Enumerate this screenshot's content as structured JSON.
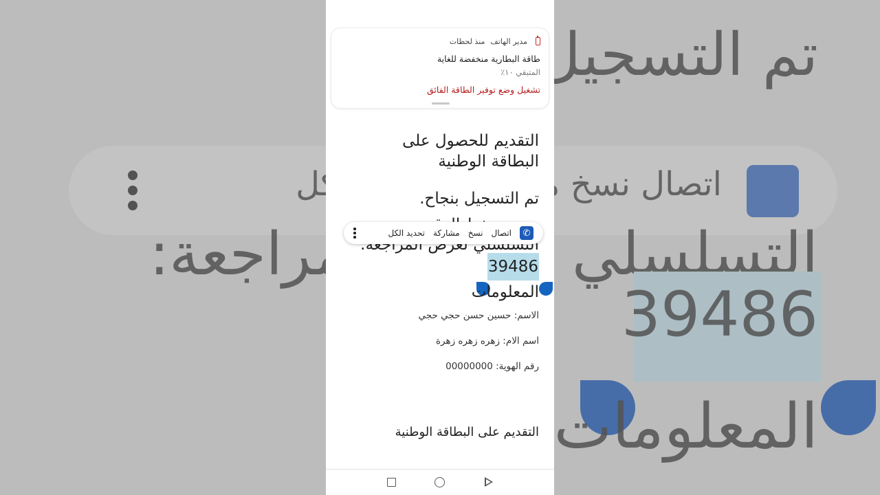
{
  "notification": {
    "app_name": "مدير الهاتف",
    "time": "منذ لحظات",
    "title": "طاقة البطارية منخفضة للغاية",
    "subtitle": "المتبقي ١٠٪",
    "action": "تشغيل وضع توفير الطاقة الفائق"
  },
  "page": {
    "heading_main": "التقديم للحصول على البطاقة الوطنية",
    "success_text": "تم التسجيل بنجاح.",
    "partial_line1": "يرجى حفظ الرقم",
    "partial_line2": "التسلسلي لغرض المراجعة:",
    "selected_number": "39486",
    "info_heading": "المعلومات",
    "name_line": "الاسم: حسين حسن حجي حجي",
    "mother_line": "اسم الام: زهره زهره زهرة",
    "id_line": "رقم الهوية: 00000000",
    "footer_heading": "التقديم على البطاقة الوطنية"
  },
  "toolbar": {
    "call": "اتصال",
    "copy": "نسخ",
    "share": "مشاركة",
    "select_all": "تحديد الكل"
  },
  "background": {
    "line1": "تم التسجيل بنجاح.",
    "menu_text": "اتصال   نسخ   مشاركة   تحديد الكل",
    "line2": "التسلسلي لغرض المراجعة:",
    "number": "39486",
    "line3": "المعلومات"
  },
  "colors": {
    "accent": "#1565c0",
    "warning": "#b71c1c",
    "selection": "#b6dcea"
  }
}
